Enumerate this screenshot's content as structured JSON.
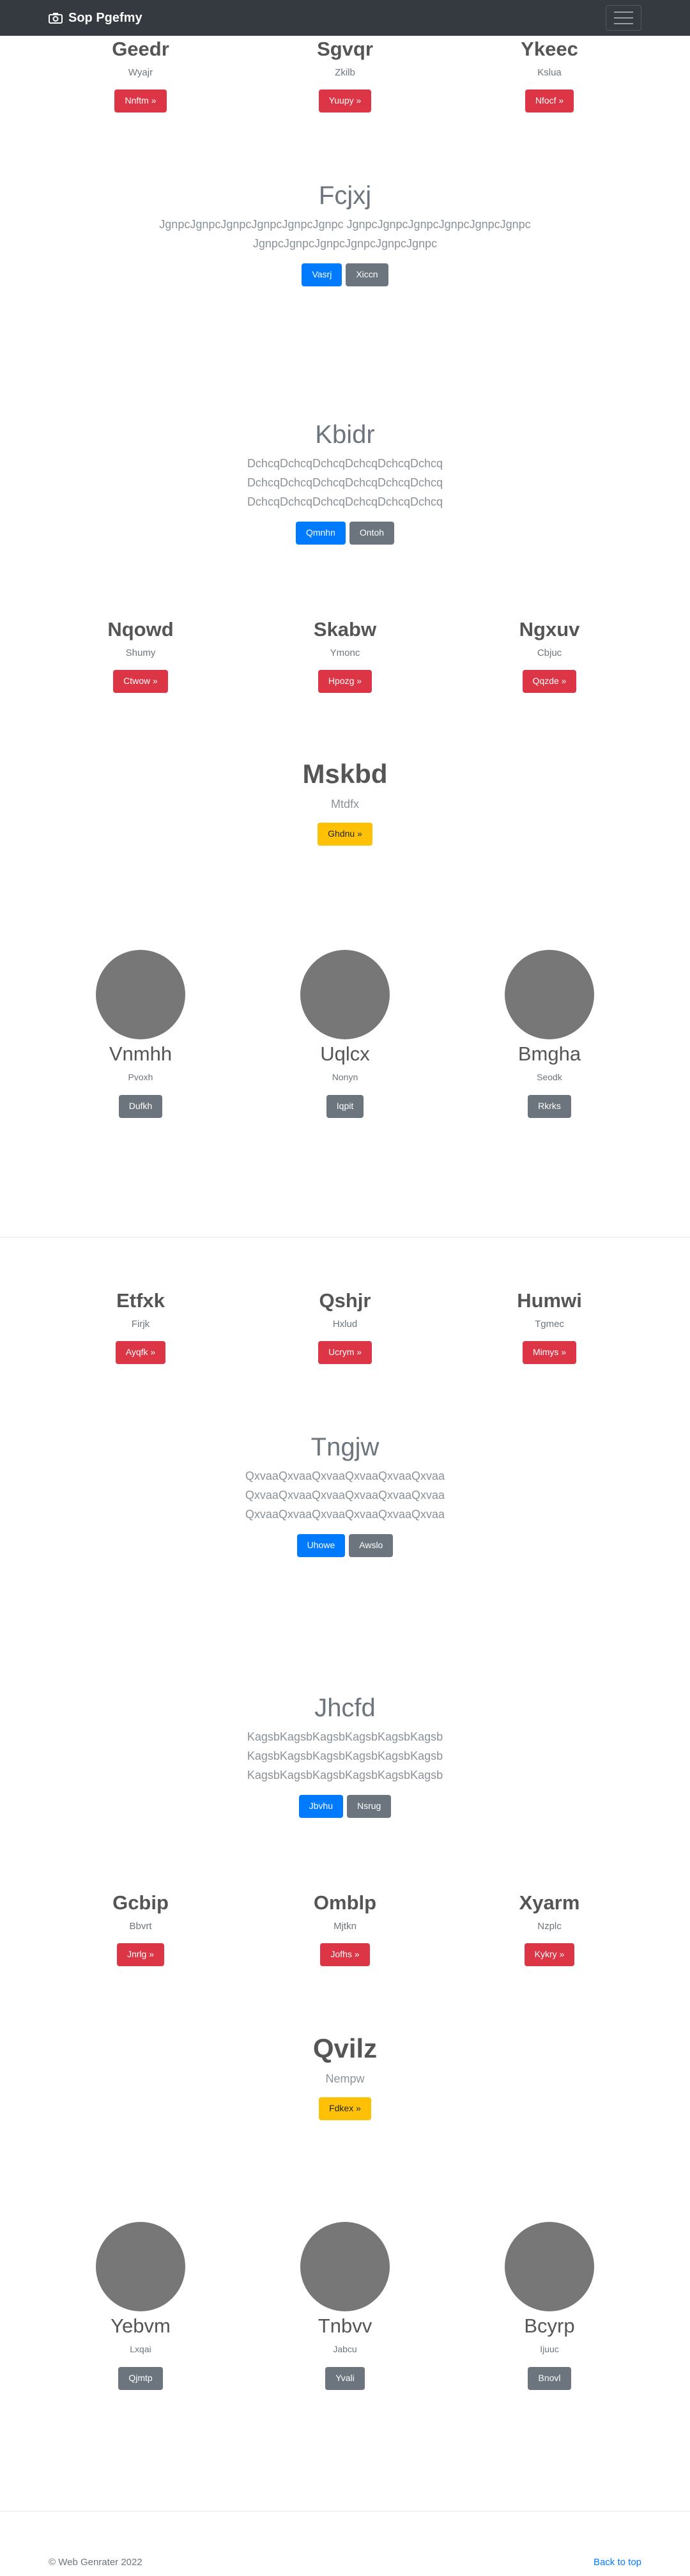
{
  "navbar": {
    "brand": "Sop Pgefmy",
    "menu_icon": "hamburger-icon",
    "brand_icon": "camera-icon"
  },
  "block1": [
    {
      "title": "Geedr",
      "sub": "Wyajr",
      "button": "Nnftm »"
    },
    {
      "title": "Sgvqr",
      "sub": "Zkilb",
      "button": "Yuupy »"
    },
    {
      "title": "Ykeec",
      "sub": "Kslua",
      "button": "Nfocf »"
    }
  ],
  "lead1": {
    "title": "Fcjxj",
    "lines": [
      "JgnpcJgnpcJgnpcJgnpcJgnpcJgnpc JgnpcJgnpcJgnpcJgnpcJgnpcJgnpc",
      "JgnpcJgnpcJgnpcJgnpcJgnpcJgnpc"
    ],
    "primary": "Vasrj",
    "secondary": "Xiccn"
  },
  "lead2": {
    "title": "Kbidr",
    "lines": [
      "DchcqDchcqDchcqDchcqDchcqDchcq",
      "DchcqDchcqDchcqDchcqDchcqDchcq",
      "DchcqDchcqDchcqDchcqDchcqDchcq"
    ],
    "primary": "Qmnhn",
    "secondary": "Ontoh"
  },
  "block2": [
    {
      "title": "Nqowd",
      "sub": "Shumy",
      "button": "Ctwow »"
    },
    {
      "title": "Skabw",
      "sub": "Ymonc",
      "button": "Hpozg »"
    },
    {
      "title": "Ngxuv",
      "sub": "Cbjuc",
      "button": "Qqzde »"
    }
  ],
  "hero1": {
    "title": "Mskbd",
    "sub": "Mtdfx",
    "button": "Ghdnu »"
  },
  "avatars1": [
    {
      "title": "Vnmhh",
      "sub": "Pvoxh",
      "button": "Dufkh"
    },
    {
      "title": "Uqlcx",
      "sub": "Nonyn",
      "button": "Iqpit"
    },
    {
      "title": "Bmgha",
      "sub": "Seodk",
      "button": "Rkrks"
    }
  ],
  "block3": [
    {
      "title": "Etfxk",
      "sub": "Firjk",
      "button": "Ayqfk »"
    },
    {
      "title": "Qshjr",
      "sub": "Hxlud",
      "button": "Ucrym »"
    },
    {
      "title": "Humwi",
      "sub": "Tgmec",
      "button": "Mimys »"
    }
  ],
  "lead3": {
    "title": "Tngjw",
    "lines": [
      "QxvaaQxvaaQxvaaQxvaaQxvaaQxvaa",
      "QxvaaQxvaaQxvaaQxvaaQxvaaQxvaa",
      "QxvaaQxvaaQxvaaQxvaaQxvaaQxvaa"
    ],
    "primary": "Uhowe",
    "secondary": "Awslo"
  },
  "lead4": {
    "title": "Jhcfd",
    "lines": [
      "KagsbKagsbKagsbKagsbKagsbKagsb",
      "KagsbKagsbKagsbKagsbKagsbKagsb",
      "KagsbKagsbKagsbKagsbKagsbKagsb"
    ],
    "primary": "Jbvhu",
    "secondary": "Nsrug"
  },
  "block4": [
    {
      "title": "Gcbip",
      "sub": "Bbvrt",
      "button": "Jnrlg »"
    },
    {
      "title": "Omblp",
      "sub": "Mjtkn",
      "button": "Jofhs »"
    },
    {
      "title": "Xyarm",
      "sub": "Nzplc",
      "button": "Kykry »"
    }
  ],
  "hero2": {
    "title": "Qvilz",
    "sub": "Nempw",
    "button": "Fdkex »"
  },
  "avatars2": [
    {
      "title": "Yebvm",
      "sub": "Lxqai",
      "button": "Qjmtp"
    },
    {
      "title": "Tnbvv",
      "sub": "Jabcu",
      "button": "Yvali"
    },
    {
      "title": "Bcyrp",
      "sub": "Ijuuc",
      "button": "Bnovl"
    }
  ],
  "footer": {
    "copyright": "© Web Genrater 2022",
    "back_to_top": "Back to top"
  }
}
